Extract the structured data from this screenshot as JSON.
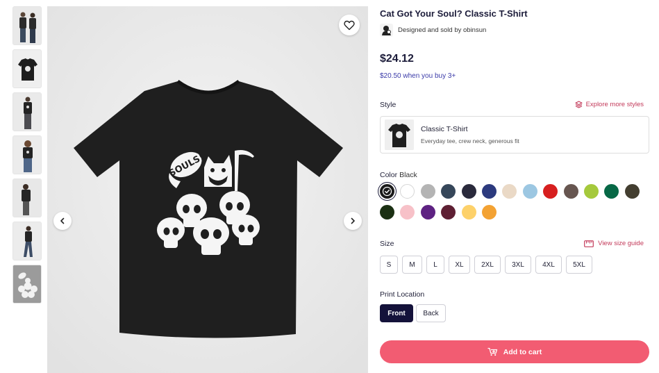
{
  "product": {
    "title": "Cat Got Your Soul? Classic T-Shirt",
    "seller_text": "Designed and sold by obinsun",
    "price": "$24.12",
    "bulk_price": "$20.50 when you buy 3+"
  },
  "gallery": {
    "thumbnails": [
      "model-pair",
      "tee-flat-black",
      "model-front",
      "model-woman",
      "model-side",
      "model-walk",
      "artwork"
    ],
    "active_index": 6,
    "icons": {
      "favorite": "heart-icon",
      "prev": "chevron-left-icon",
      "next": "chevron-right-icon"
    },
    "artwork_text": "SOULS!"
  },
  "style": {
    "label": "Style",
    "explore_label": "Explore more styles",
    "selected_name": "Classic T-Shirt",
    "selected_desc": "Everyday tee, crew neck, generous fit"
  },
  "color": {
    "label": "Color",
    "selected": "Black",
    "swatches": [
      "#1a1a1a",
      "#ffffff",
      "#b4b4b4",
      "#36475a",
      "#2a2a3c",
      "#2c3a7e",
      "#ead9c6",
      "#9cc7e2",
      "#d71f1f",
      "#675650",
      "#a5c93c",
      "#076846",
      "#433e30",
      "#1b3013",
      "#f7c1c8",
      "#5e2282",
      "#5e1f33",
      "#fdd16a",
      "#f3a233"
    ]
  },
  "size": {
    "label": "Size",
    "guide_label": "View size guide",
    "options": [
      "S",
      "M",
      "L",
      "XL",
      "2XL",
      "3XL",
      "4XL",
      "5XL"
    ]
  },
  "print_location": {
    "label": "Print Location",
    "options": [
      "Front",
      "Back"
    ],
    "selected": "Front"
  },
  "cart": {
    "label": "Add to cart"
  }
}
